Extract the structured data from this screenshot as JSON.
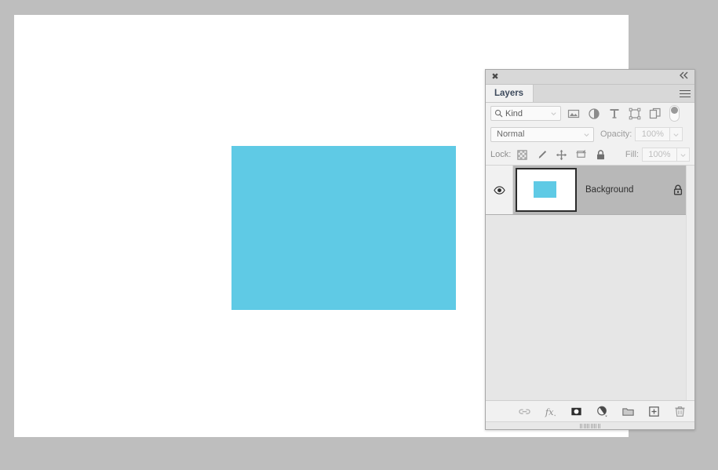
{
  "workspace": {
    "background_color": "#bebebe"
  },
  "document": {
    "canvas_color": "#ffffff",
    "shape": {
      "name": "rectangle",
      "fill_color": "#5fcae5"
    }
  },
  "panel": {
    "title": "Layers",
    "close_icon": "✖",
    "collapse_icon": "«",
    "menu_icon": "panel-menu-icon",
    "filter": {
      "search_icon": "search-icon",
      "kind_label": "Kind",
      "caret_icon": "chevron-down-icon",
      "type_filters": [
        {
          "name": "pixel-layer-filter-icon",
          "title": "Filter for pixel layers"
        },
        {
          "name": "adjustment-layer-filter-icon",
          "title": "Filter for adjustment layers"
        },
        {
          "name": "type-layer-filter-icon",
          "title": "Filter for type layers"
        },
        {
          "name": "shape-layer-filter-icon",
          "title": "Filter for shape layers"
        },
        {
          "name": "smart-object-filter-icon",
          "title": "Filter for smart objects"
        }
      ],
      "toggle_name": "filter-enable-toggle"
    },
    "blend": {
      "mode": "Normal",
      "caret_icon": "chevron-down-icon",
      "opacity_label": "Opacity:",
      "opacity_value": "100%",
      "fill_label": "Fill:",
      "fill_value": "100%"
    },
    "lock": {
      "label": "Lock:",
      "items": [
        {
          "name": "lock-transparent-pixels-icon",
          "title": "Lock transparent pixels"
        },
        {
          "name": "lock-image-pixels-icon",
          "title": "Lock image pixels"
        },
        {
          "name": "lock-position-icon",
          "title": "Lock position"
        },
        {
          "name": "lock-artboard-nesting-icon",
          "title": "Prevent auto-nesting"
        },
        {
          "name": "lock-all-icon",
          "title": "Lock all"
        }
      ]
    },
    "layers": [
      {
        "name": "Background",
        "visible": true,
        "locked": true,
        "selected": true,
        "thumbnail_fill": "#5fcae5"
      }
    ],
    "footer_buttons": [
      {
        "name": "link-layers-button",
        "label": "Link layers"
      },
      {
        "name": "layer-style-button",
        "label": "Add a layer style"
      },
      {
        "name": "layer-mask-button",
        "label": "Add layer mask"
      },
      {
        "name": "adjustment-layer-button",
        "label": "Create new fill or adjustment layer"
      },
      {
        "name": "new-group-button",
        "label": "Create a new group"
      },
      {
        "name": "new-layer-button",
        "label": "Create a new layer"
      },
      {
        "name": "delete-layer-button",
        "label": "Delete layer"
      }
    ]
  }
}
